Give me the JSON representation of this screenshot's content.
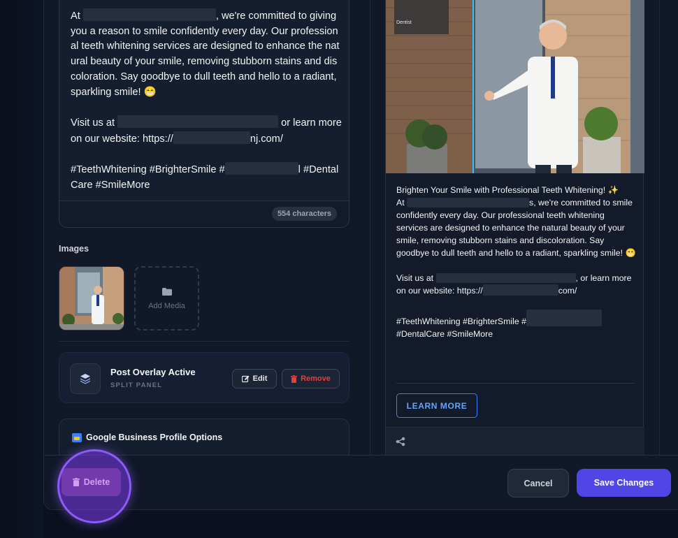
{
  "editor": {
    "post_text_part1": "At ",
    "post_text_part2": ", we're committed to giving you a reason to smile confidently every day. Our professional teeth whitening services are designed to enhance the natural beauty of your smile, removing stubborn stains and discoloration. Say goodbye to dull teeth and hello to a radiant, sparkling smile! 😁\n\nVisit us at ",
    "post_text_part3": " or learn more on our website: https://",
    "post_text_part4": "nj.com/\n\n#TeethWhitening #BrighterSmile #",
    "post_text_part5": "l #DentalCare #SmileMore",
    "char_count": "554 characters"
  },
  "images": {
    "label": "Images",
    "add_media_label": "Add Media"
  },
  "overlay": {
    "title": "Post Overlay Active",
    "subtitle": "SPLIT PANEL",
    "edit_label": "Edit",
    "remove_label": "Remove"
  },
  "gbp": {
    "title": "Google Business Profile Options"
  },
  "preview": {
    "image_sign_text": "Dentist",
    "headline": "Brighten Your Smile with Professional Teeth Whitening! ✨",
    "body_part1": "At ",
    "body_part2": "s, we're committed to smile confidently every day. Our professional teeth whitening services are designed to enhance the natural beauty of your smile, removing stubborn stains and discoloration. Say goodbye to dull teeth and hello to a radiant, sparkling smile! 😁\n\nVisit us at ",
    "body_part3": ", or learn more on our website: https://",
    "body_part4": "com/\n\n#TeethWhitening #BrighterSmile #",
    "body_part5": "\n#DentalCare #SmileMore",
    "cta_label": "LEARN MORE"
  },
  "footer": {
    "delete_label": "Delete",
    "cancel_label": "Cancel",
    "save_label": "Save Changes"
  },
  "colors": {
    "accent": "#4f46e5",
    "danger": "#e53e3e",
    "cta_border": "#3b82f6",
    "highlight_ring": "#8b5cf6"
  },
  "icons": {
    "layers": "layers-icon",
    "folder": "folder-icon",
    "edit": "pencil-icon",
    "remove": "trash-icon",
    "share": "share-icon",
    "gbp": "business-icon",
    "delete": "trash-icon"
  }
}
